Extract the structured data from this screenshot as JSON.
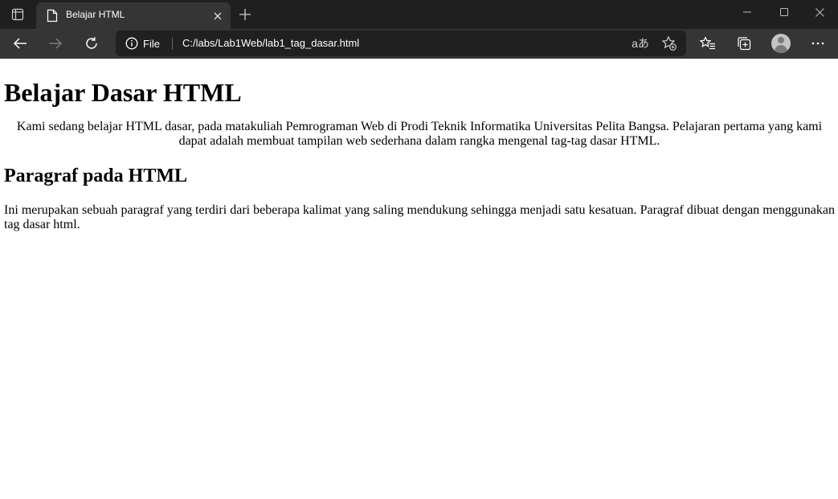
{
  "browser": {
    "tab": {
      "title": "Belajar HTML"
    },
    "site_info_label": "File",
    "url": "C:/labs/Lab1Web/lab1_tag_dasar.html",
    "read_aloud_glyph": "aあ"
  },
  "page": {
    "heading1": "Belajar Dasar HTML",
    "intro": "Kami sedang belajar HTML dasar, pada matakuliah Pemrograman Web di Prodi Teknik Informatika Universitas Pelita Bangsa. Pelajaran pertama yang kami dapat adalah membuat tampilan web sederhana dalam rangka mengenal tag-tag dasar HTML.",
    "heading2": "Paragraf pada HTML",
    "paragraph": "Ini merupakan sebuah paragraf yang terdiri dari beberapa kalimat yang saling mendukung sehingga menjadi satu kesatuan. Paragraf dibuat dengan menggunakan tag dasar html."
  },
  "icons": {
    "tab_actions": "tab-actions-icon",
    "favicon": "page-document-icon",
    "close": "close-icon",
    "new_tab": "plus-icon",
    "minimize": "minimize-icon",
    "maximize": "maximize-icon",
    "window_close": "window-close-icon",
    "back": "back-arrow-icon",
    "forward": "forward-arrow-icon",
    "refresh": "refresh-icon",
    "info": "info-icon",
    "add_favorite": "add-favorite-icon",
    "favorites": "favorites-icon",
    "collections": "collections-icon",
    "profile": "profile-icon",
    "more": "more-icon"
  },
  "colors": {
    "titlebar": "#1f1f1f",
    "toolbar": "#353535",
    "omnibox": "#202020",
    "page_background": "#ffffff",
    "text": "#000000"
  }
}
